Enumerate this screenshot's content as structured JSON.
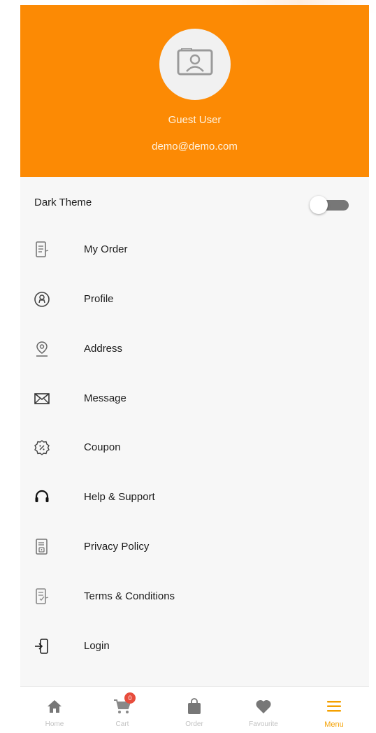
{
  "profile": {
    "name": "Guest User",
    "email": "demo@demo.com",
    "avatar_icon": "portrait-frame-icon",
    "header_color": "#fc8a04"
  },
  "settings": {
    "dark_theme_label": "Dark Theme",
    "dark_theme_enabled": false
  },
  "menu": {
    "items": [
      {
        "label": "My Order",
        "icon": "order-list-icon"
      },
      {
        "label": "Profile",
        "icon": "profile-icon"
      },
      {
        "label": "Address",
        "icon": "location-pin-icon"
      },
      {
        "label": "Message",
        "icon": "envelope-icon"
      },
      {
        "label": "Coupon",
        "icon": "coupon-icon"
      },
      {
        "label": "Help & Support",
        "icon": "headset-icon"
      },
      {
        "label": "Privacy Policy",
        "icon": "privacy-document-icon"
      },
      {
        "label": "Terms & Conditions",
        "icon": "terms-document-icon"
      },
      {
        "label": "Login",
        "icon": "login-door-icon"
      }
    ]
  },
  "bottom_nav": {
    "items": [
      {
        "label": "Home",
        "icon": "home-icon",
        "active": false
      },
      {
        "label": "Cart",
        "icon": "cart-icon",
        "active": false,
        "badge": "0"
      },
      {
        "label": "Order",
        "icon": "shopping-bag-icon",
        "active": false
      },
      {
        "label": "Favourite",
        "icon": "heart-icon",
        "active": false
      },
      {
        "label": "Menu",
        "icon": "hamburger-menu-icon",
        "active": true
      }
    ],
    "active_color": "#f4a000"
  }
}
